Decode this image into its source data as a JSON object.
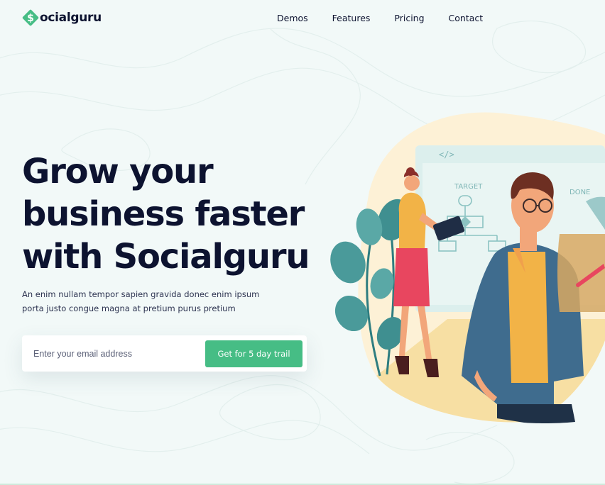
{
  "brand": {
    "name": "ocialguru",
    "icon": "dollar-icon"
  },
  "nav": {
    "items": [
      "Demos",
      "Features",
      "Pricing",
      "Contact"
    ]
  },
  "hero": {
    "title_lines": [
      "Grow your",
      "business faster",
      "with Socialguru"
    ],
    "subtitle_lines": [
      "An enim nullam tempor sapien gravida donec enim ipsum",
      "porta justo  congue magna at pretium purus pretium"
    ]
  },
  "signup": {
    "placeholder": "Enter your email address",
    "button_label": "Get for 5 day trail"
  },
  "illustration": {
    "board_code_label": "</>",
    "board_target_label": "TARGET",
    "board_done_label": "DONE"
  },
  "colors": {
    "background": "#f2f9f8",
    "accent": "#46bd85",
    "heading": "#0d1330",
    "blob": "#fdf1d6"
  }
}
